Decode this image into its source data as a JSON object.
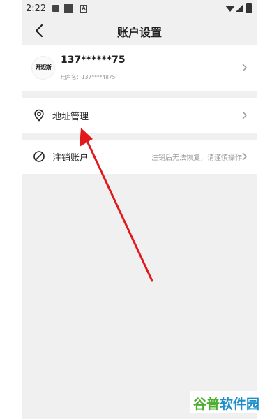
{
  "status_bar": {
    "time": "2:22",
    "icons": [
      "image-icon",
      "square-icon",
      "a-icon",
      "wifi-icon",
      "signal-icon",
      "battery-icon"
    ]
  },
  "header": {
    "title": "账户设置",
    "back_icon": "chevron-left-icon"
  },
  "account": {
    "logo_text": "开迈斯",
    "phone": "137******75",
    "username": "用户名：137****4875",
    "chevron_icon": "chevron-right-icon"
  },
  "address": {
    "icon": "location-pin-icon",
    "label": "地址管理",
    "chevron_icon": "chevron-right-icon"
  },
  "cancel_account": {
    "icon": "prohibited-icon",
    "label": "注销账户",
    "hint": "注销后无法恢复，请谨慎操作",
    "chevron_icon": "chevron-right-icon"
  },
  "watermark": {
    "text_part1": "谷普",
    "text_part2": "软件园"
  },
  "colors": {
    "page_background": "#f0f0f0",
    "card_background": "#ffffff",
    "annotation_arrow": "#e0191b",
    "watermark_green": "#4cae2f",
    "watermark_blue": "#1e8fc9"
  }
}
